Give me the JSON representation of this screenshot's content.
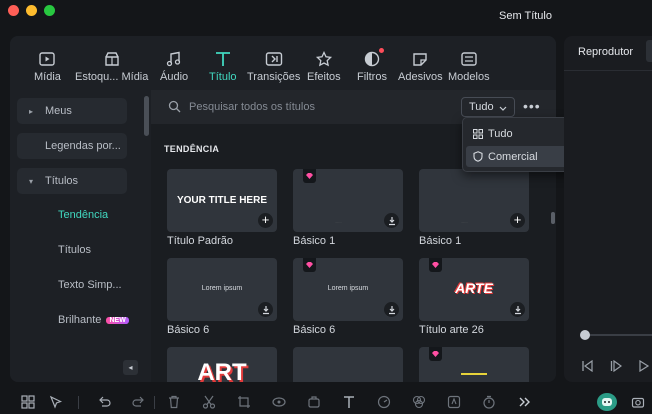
{
  "window": {
    "title": "Sem Título"
  },
  "toolbar": {
    "items": [
      {
        "label": "Mídia",
        "icon": "media-icon"
      },
      {
        "label": "Estoqu... Mídia",
        "icon": "stock-media-icon"
      },
      {
        "label": "Áudio",
        "icon": "audio-icon"
      },
      {
        "label": "Título",
        "icon": "title-icon"
      },
      {
        "label": "Transições",
        "icon": "transitions-icon"
      },
      {
        "label": "Efeitos",
        "icon": "effects-icon"
      },
      {
        "label": "Filtros",
        "icon": "filters-icon"
      },
      {
        "label": "Adesivos",
        "icon": "stickers-icon"
      },
      {
        "label": "Modelos",
        "icon": "templates-icon"
      }
    ],
    "active": "Título",
    "accent": "#41d8c0"
  },
  "sidebar": {
    "items": [
      {
        "label": "Meus"
      },
      {
        "label": "Legendas por..."
      },
      {
        "label": "Títulos"
      }
    ],
    "subitems": [
      {
        "label": "Tendência"
      },
      {
        "label": "Títulos"
      },
      {
        "label": "Texto Simp..."
      },
      {
        "label": "Brilhante",
        "badge": "NEW"
      }
    ]
  },
  "search": {
    "placeholder": "Pesquisar todos os títulos"
  },
  "filter": {
    "selected": "Tudo"
  },
  "dropdown": {
    "options": [
      "Tudo",
      "Comercial"
    ],
    "highlighted": "Comercial"
  },
  "section": {
    "title": "TENDÊNCIA"
  },
  "cards": [
    {
      "label": "Título Padrão",
      "preview": "YOUR TITLE HERE"
    },
    {
      "label": "Básico 1",
      "preview": "........"
    },
    {
      "label": "Básico 1",
      "preview": "........"
    },
    {
      "label": "Básico 6",
      "preview": "Lorem ipsum"
    },
    {
      "label": "Básico 6",
      "preview": "Lorem ipsum"
    },
    {
      "label": "Título arte 26",
      "preview": "ARTE"
    },
    {
      "preview": "ART"
    }
  ],
  "player": {
    "title": "Reprodutor"
  }
}
